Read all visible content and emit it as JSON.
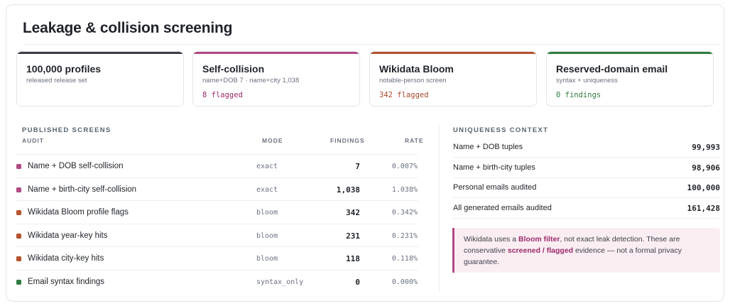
{
  "title": "Leakage & collision screening",
  "cards": [
    {
      "title": "100,000 profiles",
      "subtitle": "released release set",
      "footer": "",
      "accent": "#3b3e45",
      "footer_color": "#1f2328"
    },
    {
      "title": "Self-collision",
      "subtitle": "name+DOB 7 · name+city 1,038",
      "footer": "8 flagged",
      "accent": "#b04a83",
      "footer_color": "#9b2b6b"
    },
    {
      "title": "Wikidata Bloom",
      "subtitle": "notable-person screen",
      "footer": "342 flagged",
      "accent": "#b5532f",
      "footer_color": "#a8492a"
    },
    {
      "title": "Reserved-domain email",
      "subtitle": "syntax + uniqueness",
      "footer": "0 findings",
      "accent": "#2f7d3f",
      "footer_color": "#2f7d3f"
    }
  ],
  "published": {
    "heading": "PUBLISHED SCREENS",
    "columns": {
      "audit": "AUDIT",
      "mode": "MODE",
      "findings": "FINDINGS",
      "rate": "RATE"
    },
    "rows": [
      {
        "label": "Name + DOB self-collision",
        "mode": "exact",
        "findings": "7",
        "rate": "0.007%",
        "color": "#b04a83"
      },
      {
        "label": "Name + birth-city self-collision",
        "mode": "exact",
        "findings": "1,038",
        "rate": "1.038%",
        "color": "#b04a83"
      },
      {
        "label": "Wikidata Bloom profile flags",
        "mode": "bloom",
        "findings": "342",
        "rate": "0.342%",
        "color": "#b5532f"
      },
      {
        "label": "Wikidata year-key hits",
        "mode": "bloom",
        "findings": "231",
        "rate": "0.231%",
        "color": "#b5532f"
      },
      {
        "label": "Wikidata city-key hits",
        "mode": "bloom",
        "findings": "118",
        "rate": "0.118%",
        "color": "#b5532f"
      },
      {
        "label": "Email syntax findings",
        "mode": "syntax_only",
        "findings": "0",
        "rate": "0.000%",
        "color": "#2f7d3f"
      }
    ]
  },
  "uniqueness": {
    "heading": "UNIQUENESS CONTEXT",
    "rows": [
      {
        "label": "Name + DOB tuples",
        "value": "99,993"
      },
      {
        "label": "Name + birth-city tuples",
        "value": "98,906"
      },
      {
        "label": "Personal emails audited",
        "value": "100,000"
      },
      {
        "label": "All generated emails audited",
        "value": "161,428"
      }
    ]
  },
  "note": {
    "t1": "Wikidata uses a ",
    "b1": "Bloom filter",
    "t2": ", not exact leak detection. These are conservative ",
    "b2": "screened / flagged",
    "t3": " evidence — not a formal privacy guarantee."
  }
}
